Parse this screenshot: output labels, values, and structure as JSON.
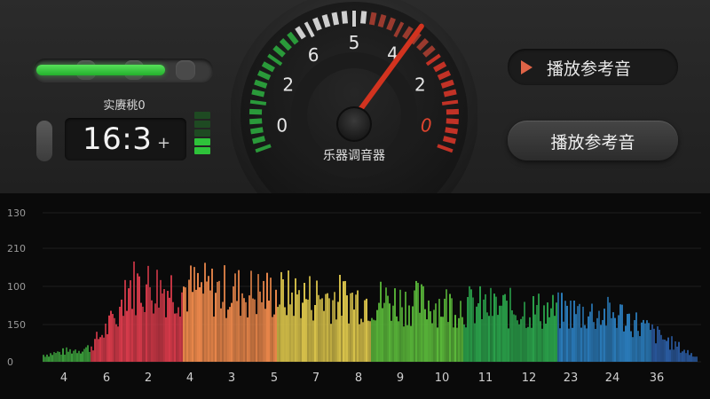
{
  "level_meter": {
    "level": 0.74
  },
  "status": {
    "label": "实赓䄻0"
  },
  "clock": {
    "time": "16:3",
    "suffix": "+"
  },
  "signal": {
    "active_bars": 2,
    "total_bars": 5,
    "active_color": "#2ec23a",
    "inactive_color": "#1e4a22"
  },
  "tuner": {
    "label": "乐器调音器",
    "scale_labels": [
      "0",
      "2",
      "6",
      "5",
      "4",
      "2",
      "0"
    ],
    "needle_value": 2.6,
    "colors": {
      "green": "#2a9a3a",
      "red": "#c23226",
      "needle": "#d2331f"
    }
  },
  "buttons": {
    "play_reference_top": {
      "label": "播放参考音",
      "icon": "play-icon"
    },
    "play_reference_main": {
      "label": "播放参考音"
    }
  },
  "spectrum": {
    "y_ticks": [
      "0",
      "150",
      "100",
      "210",
      "130"
    ],
    "x_ticks": [
      "4",
      "6",
      "2",
      "4",
      "3",
      "5",
      "7",
      "8",
      "9",
      "10",
      "11",
      "12",
      "23",
      "24",
      "36"
    ],
    "gradient": [
      "#3a9a3a",
      "#d63a4a",
      "#e8864a",
      "#d8c24a",
      "#5ab83a",
      "#2aa04a",
      "#2a7ab8",
      "#2a5aa0"
    ]
  }
}
